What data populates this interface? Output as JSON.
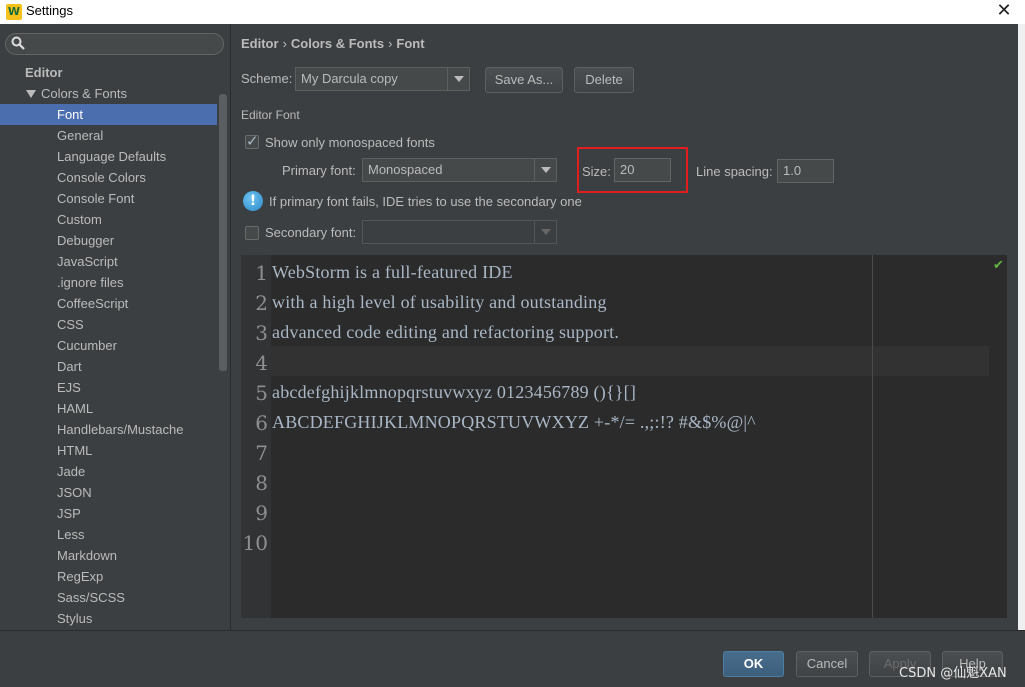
{
  "window": {
    "title": "Settings",
    "close_glyph": "✕"
  },
  "sidebar": {
    "search_placeholder": "",
    "root": "Editor",
    "group": "Colors & Fonts",
    "items": [
      "Font",
      "General",
      "Language Defaults",
      "Console Colors",
      "Console Font",
      "Custom",
      "Debugger",
      "JavaScript",
      ".ignore files",
      "CoffeeScript",
      "CSS",
      "Cucumber",
      "Dart",
      "EJS",
      "HAML",
      "Handlebars/Mustache",
      "HTML",
      "Jade",
      "JSON",
      "JSP",
      "Less",
      "Markdown",
      "RegExp",
      "Sass/SCSS",
      "Stylus"
    ],
    "selected": "Font"
  },
  "breadcrumb": {
    "part1": "Editor",
    "part2": "Colors & Fonts",
    "part3": "Font",
    "sep": "›"
  },
  "scheme": {
    "label": "Scheme:",
    "value": "My Darcula copy",
    "save_as": "Save As...",
    "delete": "Delete"
  },
  "editor_font": {
    "section_title": "Editor Font",
    "mono_only_label": "Show only monospaced fonts",
    "mono_only_checked": true,
    "primary_label": "Primary font:",
    "primary_value": "Monospaced",
    "size_label": "Size:",
    "size_value": "20",
    "line_spacing_label": "Line spacing:",
    "line_spacing_value": "1.0",
    "info_text": "If primary font fails, IDE tries to use the secondary one",
    "secondary_label": "Secondary font:",
    "secondary_checked": false,
    "secondary_value": ""
  },
  "preview": {
    "line_numbers": [
      "1",
      "2",
      "3",
      "4",
      "5",
      "6",
      "7",
      "8",
      "9",
      "10"
    ],
    "lines": [
      "WebStorm is a full-featured IDE",
      "with a high level of usability and outstanding",
      "advanced code editing and refactoring support.",
      "",
      "abcdefghijklmnopqrstuvwxyz 0123456789 (){}[]",
      "ABCDEFGHIJKLMNOPQRSTUVWXYZ +-*/= .,;:!? #&$%@|^",
      "",
      "",
      "",
      ""
    ]
  },
  "buttons": {
    "ok": "OK",
    "cancel": "Cancel",
    "apply": "Apply",
    "help": "Help"
  },
  "watermark": "CSDN @仙魁XAN",
  "colors": {
    "selection": "#4b6eaf",
    "highlight_box": "#e01e1e",
    "background": "#3c3f41",
    "editor_bg": "#2b2b2b"
  }
}
